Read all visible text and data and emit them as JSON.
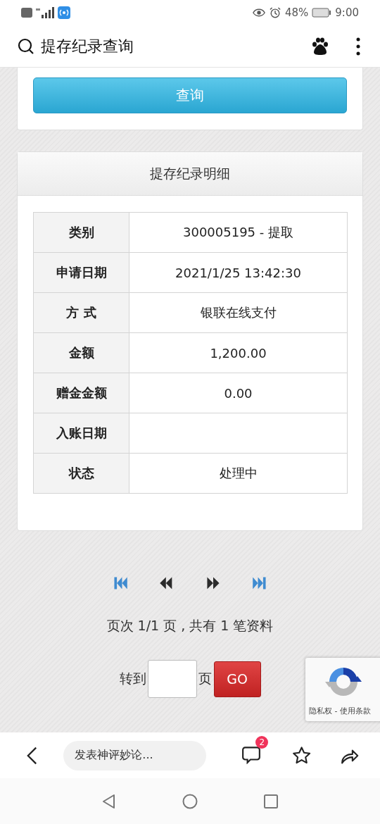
{
  "status_bar": {
    "battery": "48%",
    "time": "9:00"
  },
  "header": {
    "title": "提存纪录查询"
  },
  "query_button": "查询",
  "details": {
    "title": "提存纪录明细",
    "rows": [
      {
        "label": "类别",
        "value": "300005195 - 提取"
      },
      {
        "label": "申请日期",
        "value": "2021/1/25 13:42:30"
      },
      {
        "label": "方 式",
        "value": "银联在线支付"
      },
      {
        "label": "金额",
        "value": "1,200.00"
      },
      {
        "label": "赠金金额",
        "value": "0.00"
      },
      {
        "label": "入账日期",
        "value": ""
      },
      {
        "label": "状态",
        "value": "处理中"
      }
    ]
  },
  "pagination": {
    "controls": [
      {
        "kind": "first"
      },
      {
        "kind": "prev"
      },
      {
        "kind": "next"
      },
      {
        "kind": "last"
      }
    ],
    "summary": "页次 1/1 页 , 共有 1 笔资料",
    "goto_label": "转到",
    "page_unit": "页",
    "go_button": "GO"
  },
  "recaptcha": {
    "links": "隐私权 - 使用条款"
  },
  "bottom_bar": {
    "comment_placeholder": "发表神评妙论...",
    "comment_count": "2"
  }
}
